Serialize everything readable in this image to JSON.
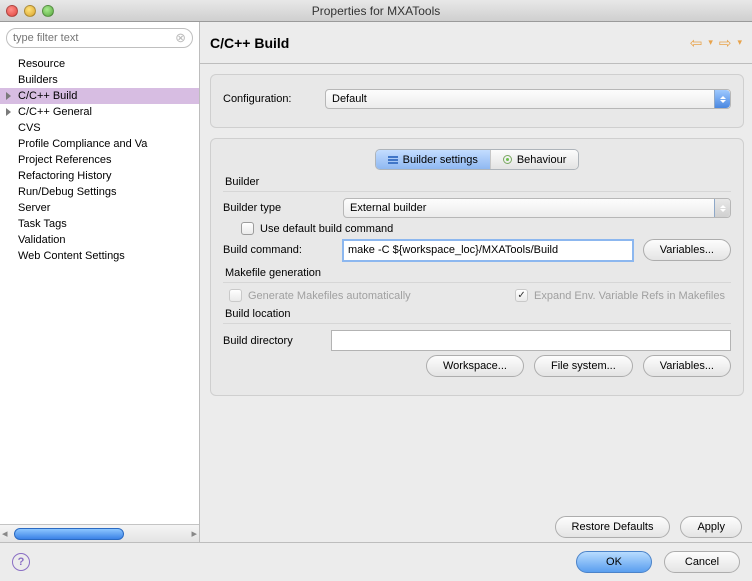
{
  "window": {
    "title": "Properties for MXATools"
  },
  "filter": {
    "placeholder": "type filter text"
  },
  "tree": {
    "items": [
      {
        "label": "Resource",
        "expandable": false
      },
      {
        "label": "Builders",
        "expandable": false
      },
      {
        "label": "C/C++ Build",
        "expandable": true,
        "selected": true
      },
      {
        "label": "C/C++ General",
        "expandable": true
      },
      {
        "label": "CVS",
        "expandable": false
      },
      {
        "label": "Profile Compliance and Va",
        "expandable": false
      },
      {
        "label": "Project References",
        "expandable": false
      },
      {
        "label": "Refactoring History",
        "expandable": false
      },
      {
        "label": "Run/Debug Settings",
        "expandable": false
      },
      {
        "label": "Server",
        "expandable": false
      },
      {
        "label": "Task Tags",
        "expandable": false
      },
      {
        "label": "Validation",
        "expandable": false
      },
      {
        "label": "Web Content Settings",
        "expandable": false
      }
    ]
  },
  "page": {
    "heading": "C/C++ Build",
    "config_label": "Configuration:",
    "config_value": "Default",
    "tabs": {
      "builder_settings": "Builder settings",
      "behaviour": "Behaviour"
    },
    "builder": {
      "heading": "Builder",
      "type_label": "Builder type",
      "type_value": "External builder",
      "use_default_label": "Use default build command",
      "use_default_checked": false,
      "build_cmd_label": "Build command:",
      "build_cmd_value": "make -C ${workspace_loc}/MXATools/Build",
      "variables_btn": "Variables..."
    },
    "makefile": {
      "heading": "Makefile generation",
      "gen_label": "Generate Makefiles automatically",
      "gen_checked": false,
      "expand_label": "Expand Env. Variable Refs in Makefiles",
      "expand_checked": true
    },
    "location": {
      "heading": "Build location",
      "dir_label": "Build directory",
      "dir_value": "",
      "workspace_btn": "Workspace...",
      "filesystem_btn": "File system...",
      "variables_btn": "Variables..."
    },
    "restore_btn": "Restore Defaults",
    "apply_btn": "Apply"
  },
  "footer": {
    "ok": "OK",
    "cancel": "Cancel"
  }
}
